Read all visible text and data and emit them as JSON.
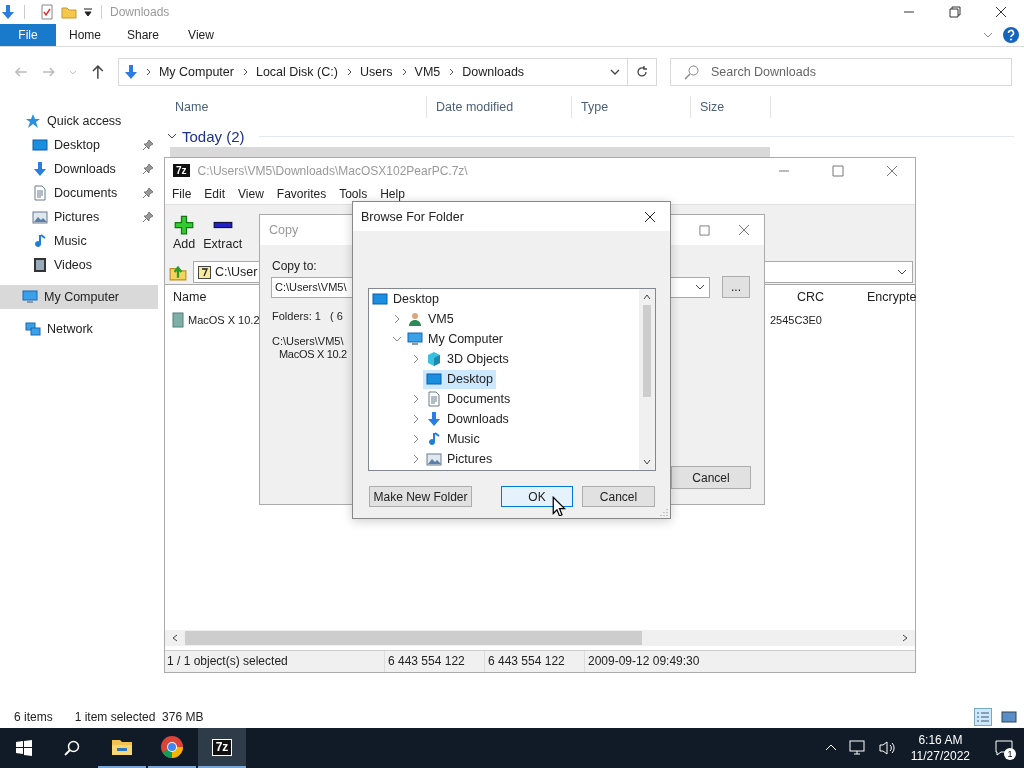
{
  "explorer": {
    "title": "Downloads",
    "ribbon_tabs": [
      {
        "label": "File",
        "selected": true
      },
      {
        "label": "Home",
        "selected": false
      },
      {
        "label": "Share",
        "selected": false
      },
      {
        "label": "View",
        "selected": false
      }
    ],
    "breadcrumb": [
      "My Computer",
      "Local Disk (C:)",
      "Users",
      "VM5",
      "Downloads"
    ],
    "search": {
      "placeholder": "Search Downloads"
    },
    "nav": [
      {
        "label": "Quick access",
        "selected": false,
        "pinned": false,
        "children": [
          {
            "label": "Desktop",
            "selected": false,
            "pinned": true
          },
          {
            "label": "Downloads",
            "selected": false,
            "pinned": true
          },
          {
            "label": "Documents",
            "selected": false,
            "pinned": true
          },
          {
            "label": "Pictures",
            "selected": false,
            "pinned": true
          },
          {
            "label": "Music",
            "selected": false,
            "pinned": false
          },
          {
            "label": "Videos",
            "selected": false,
            "pinned": false
          }
        ]
      },
      {
        "label": "My Computer",
        "selected": true,
        "pinned": false
      },
      {
        "label": "Network",
        "selected": false,
        "pinned": false
      }
    ],
    "columns": [
      "Name",
      "Date modified",
      "Type",
      "Size"
    ],
    "group": {
      "label": "Today (2)",
      "expanded": true
    },
    "status": [
      "6 items",
      "1 item selected  376 MB"
    ]
  },
  "sevenzip": {
    "logo": "7z",
    "title": "C:\\Users\\VM5\\Downloads\\MacOSX102PearPC.7z\\",
    "menu": [
      "File",
      "Edit",
      "View",
      "Favorites",
      "Tools",
      "Help"
    ],
    "toolbar": [
      "Add",
      "Extract"
    ],
    "path": "C:\\User",
    "columns": [
      "Name",
      "CRC",
      "Encrypte"
    ],
    "rows": [
      {
        "name": "MacOS X 10.2",
        "crc": "2545C3E0"
      }
    ],
    "status": [
      "1 / 1 object(s) selected",
      "6 443 554 122",
      "6 443 554 122",
      "2009-09-12 09:49:30"
    ]
  },
  "copy_dialog": {
    "title": "Copy",
    "label": "Copy to:",
    "path": "C:\\Users\\VM5\\",
    "browse_button": "...",
    "folders": "Folders: 1   ( 6",
    "details": [
      "C:\\Users\\VM5\\",
      "MacOS X 10.2"
    ],
    "button": "Cancel"
  },
  "browse_dialog": {
    "title": "Browse For Folder",
    "tree": [
      {
        "label": "Desktop",
        "selected": false,
        "children": [
          {
            "label": "VM5",
            "selected": false,
            "expanded": false
          },
          {
            "label": "My Computer",
            "selected": false,
            "expanded": true,
            "children": [
              {
                "label": "3D Objects",
                "selected": false,
                "expanded": false
              },
              {
                "label": "Desktop",
                "selected": true
              },
              {
                "label": "Documents",
                "selected": false,
                "expanded": false
              },
              {
                "label": "Downloads",
                "selected": false,
                "expanded": false
              },
              {
                "label": "Music",
                "selected": false,
                "expanded": false
              },
              {
                "label": "Pictures",
                "selected": false,
                "expanded": false
              }
            ]
          }
        ]
      }
    ],
    "buttons": [
      {
        "label": "Make New Folder",
        "default": false
      },
      {
        "label": "OK",
        "default": true
      },
      {
        "label": "Cancel",
        "default": false
      }
    ]
  },
  "taskbar": {
    "apps": [
      {
        "active": false
      },
      {
        "active": false
      },
      {
        "active": true,
        "label": "7z"
      }
    ],
    "time": "6:16 AM",
    "date": "11/27/2022",
    "notifications": "1"
  }
}
